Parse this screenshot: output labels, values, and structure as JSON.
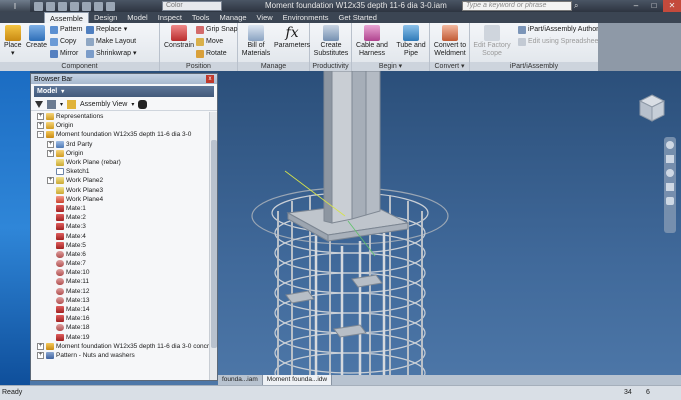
{
  "titlebar": {
    "app_letter": "I",
    "color_select": "Color",
    "title": "Moment foundation W12x35 depth 11-6 dia 3-0.iam",
    "search_placeholder": "Type a keyword or phrase",
    "search_icon": "binoculars-icon",
    "minimize": "–",
    "maximize": "□",
    "close": "✕"
  },
  "ribbon_tabs": [
    "Assemble",
    "Design",
    "Model",
    "Inspect",
    "Tools",
    "Manage",
    "View",
    "Environments",
    "Get Started"
  ],
  "ribbon": {
    "component": {
      "title": "Component",
      "place": "Place",
      "create": "Create",
      "pattern": "Pattern",
      "copy": "Copy",
      "mirror": "Mirror",
      "replace": "Replace",
      "make_layout": "Make Layout",
      "shrinkwrap": "Shrinkwrap"
    },
    "position": {
      "title": "Position",
      "constrain": "Constrain",
      "grip_snap": "Grip Snap",
      "move": "Move",
      "rotate": "Rotate"
    },
    "manage": {
      "title": "Manage",
      "bom": "Bill of Materials",
      "parameters": "Parameters"
    },
    "productivity": {
      "title": "Productivity",
      "create_substitutes": "Create Substitutes"
    },
    "begin": {
      "title": "Begin",
      "cable_harness": "Cable and Harness",
      "tube_pipe": "Tube and Pipe"
    },
    "convert": {
      "title": "Convert",
      "convert_weldment": "Convert to Weldment"
    },
    "factory": {
      "edit_factory_scope": "Edit Factory Scope"
    },
    "ipart": {
      "title": "iPart/iAssembly",
      "author": "iPart/iAssembly Author",
      "edit_spreadsheet": "Edit using Spreadsheet"
    }
  },
  "browser": {
    "title": "Browser Bar",
    "close": "x",
    "model_label": "Model",
    "model_arrow": "▾",
    "assembly_view": "Assembly View",
    "tree": [
      {
        "label": "Representations",
        "indent": 0,
        "exp": "+",
        "icon": "folder"
      },
      {
        "label": "Origin",
        "indent": 0,
        "exp": "+",
        "icon": "folder"
      },
      {
        "label": "Moment foundation W12x35 depth 11-6 dia 3-0",
        "indent": 0,
        "exp": "-",
        "icon": "assembly"
      },
      {
        "label": "3rd Party",
        "indent": 1,
        "exp": "+",
        "icon": "party"
      },
      {
        "label": "Origin",
        "indent": 1,
        "exp": "+",
        "icon": "folder"
      },
      {
        "label": "Work Plane (rebar)",
        "indent": 1,
        "exp": "",
        "icon": "plane"
      },
      {
        "label": "Sketch1",
        "indent": 1,
        "exp": "",
        "icon": "sketch"
      },
      {
        "label": "Work Plane2",
        "indent": 1,
        "exp": "+",
        "icon": "plane"
      },
      {
        "label": "Work Plane3",
        "indent": 1,
        "exp": "",
        "icon": "plane"
      },
      {
        "label": "Work Plane4",
        "indent": 1,
        "exp": "",
        "icon": "plane-red"
      },
      {
        "label": "Mate:1",
        "indent": 1,
        "exp": "",
        "icon": "mate"
      },
      {
        "label": "Mate:2",
        "indent": 1,
        "exp": "",
        "icon": "mate"
      },
      {
        "label": "Mate:3",
        "indent": 1,
        "exp": "",
        "icon": "mate"
      },
      {
        "label": "Mate:4",
        "indent": 1,
        "exp": "",
        "icon": "mate"
      },
      {
        "label": "Mate:5",
        "indent": 1,
        "exp": "",
        "icon": "mate"
      },
      {
        "label": "Mate:6",
        "indent": 1,
        "exp": "",
        "icon": "mate-link"
      },
      {
        "label": "Mate:7",
        "indent": 1,
        "exp": "",
        "icon": "mate-link"
      },
      {
        "label": "Mate:10",
        "indent": 1,
        "exp": "",
        "icon": "mate-link"
      },
      {
        "label": "Mate:11",
        "indent": 1,
        "exp": "",
        "icon": "mate-link"
      },
      {
        "label": "Mate:12",
        "indent": 1,
        "exp": "",
        "icon": "mate-link"
      },
      {
        "label": "Mate:13",
        "indent": 1,
        "exp": "",
        "icon": "mate-link"
      },
      {
        "label": "Mate:14",
        "indent": 1,
        "exp": "",
        "icon": "mate"
      },
      {
        "label": "Mate:16",
        "indent": 1,
        "exp": "",
        "icon": "mate"
      },
      {
        "label": "Mate:18",
        "indent": 1,
        "exp": "",
        "icon": "mate-link"
      },
      {
        "label": "Mate:19",
        "indent": 1,
        "exp": "",
        "icon": "mate"
      },
      {
        "label": "Moment foundation W12x35 depth 11-6 dia 3-0 concrete",
        "indent": 0,
        "exp": "+",
        "icon": "assembly"
      },
      {
        "label": "Pattern - Nuts and washers",
        "indent": 0,
        "exp": "+",
        "icon": "pattern"
      }
    ]
  },
  "doc_tabs": [
    "founda...iam",
    "Moment founda...idw"
  ],
  "status": {
    "text": "Ready",
    "count1": "34",
    "count2": "6"
  }
}
